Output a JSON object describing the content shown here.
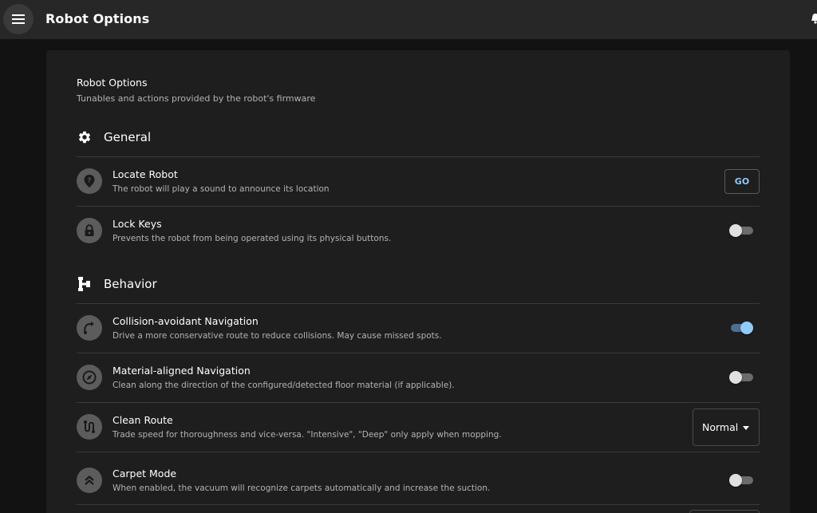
{
  "app": {
    "title": "Robot Options"
  },
  "card": {
    "title": "Robot Options",
    "subtitle": "Tunables and actions provided by the robot's firmware"
  },
  "sections": {
    "general": {
      "title": "General",
      "icon": "gear-icon",
      "items": [
        {
          "title": "Locate Robot",
          "description": "The robot will play a sound to announce its location",
          "icon": "location-question-icon",
          "action_label": "GO"
        },
        {
          "title": "Lock Keys",
          "description": "Prevents the robot from being operated using its physical buttons.",
          "icon": "lock-icon",
          "enabled": false
        }
      ]
    },
    "behavior": {
      "title": "Behavior",
      "icon": "tree-structure-icon",
      "items": [
        {
          "title": "Collision-avoidant Navigation",
          "description": "Drive a more conservative route to reduce collisions. May cause missed spots.",
          "icon": "route-curve-icon",
          "enabled": true
        },
        {
          "title": "Material-aligned Navigation",
          "description": "Clean along the direction of the configured/detected floor material (if applicable).",
          "icon": "compass-icon",
          "enabled": false
        },
        {
          "title": "Clean Route",
          "description": "Trade speed for thoroughness and vice-versa. \"Intensive\", \"Deep\" only apply when mopping.",
          "icon": "route-icon",
          "selected": "Normal"
        },
        {
          "title": "Carpet Mode",
          "description": "When enabled, the vacuum will recognize carpets automatically and increase the suction.",
          "icon": "chevrons-up-icon",
          "enabled": false
        }
      ]
    }
  },
  "colors": {
    "accent": "#90caf9",
    "appbar": "#272727",
    "card": "#1e1e1e",
    "background": "#121212"
  }
}
